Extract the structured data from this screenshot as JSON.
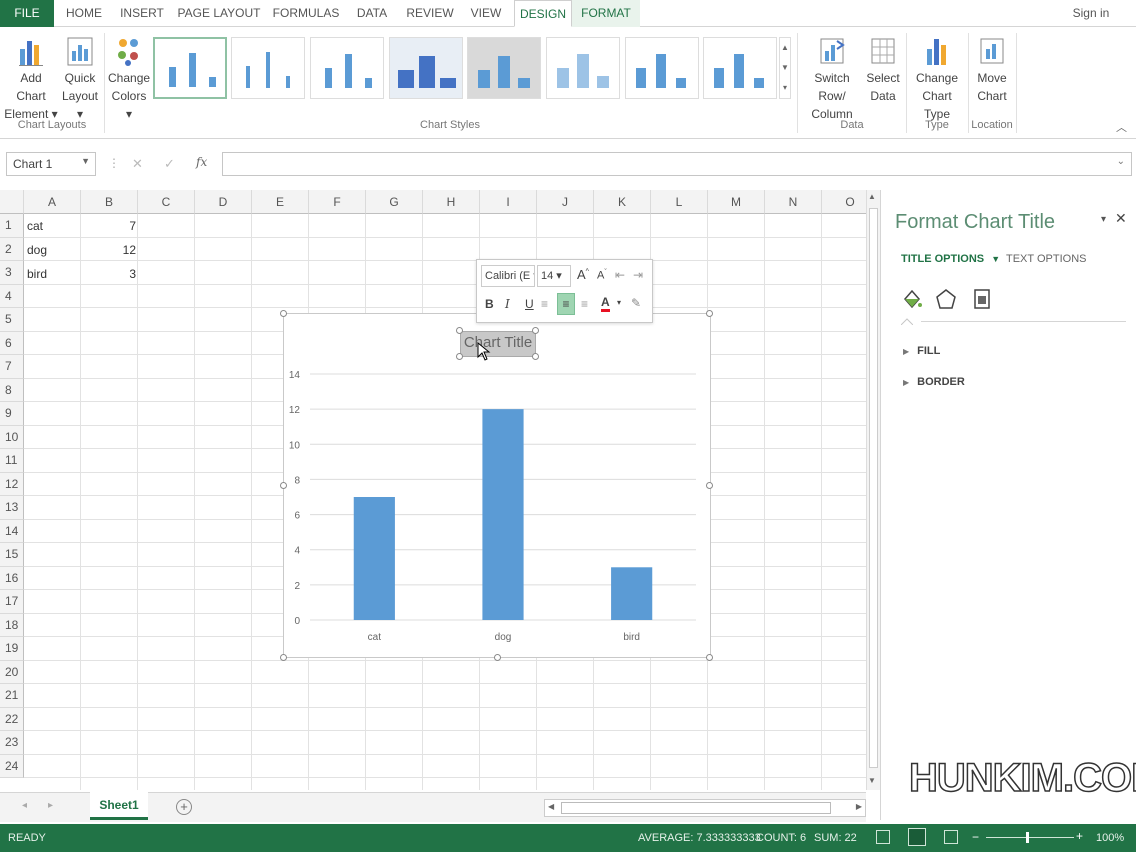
{
  "tabs": {
    "file": "FILE",
    "home": "HOME",
    "insert": "INSERT",
    "page_layout": "PAGE LAYOUT",
    "formulas": "FORMULAS",
    "data": "DATA",
    "review": "REVIEW",
    "view": "VIEW",
    "design": "DESIGN",
    "format": "FORMAT",
    "sign_in": "Sign in"
  },
  "ribbon": {
    "add_chart_element": [
      "Add Chart",
      "Element"
    ],
    "quick_layout": [
      "Quick",
      "Layout"
    ],
    "change_colors": [
      "Change",
      "Colors"
    ],
    "switch_row_column": [
      "Switch Row/",
      "Column"
    ],
    "select_data": [
      "Select",
      "Data"
    ],
    "change_chart_type": [
      "Change",
      "Chart Type"
    ],
    "move_chart": [
      "Move",
      "Chart"
    ],
    "groups": {
      "chart_layouts": "Chart Layouts",
      "chart_styles": "Chart Styles",
      "data": "Data",
      "type": "Type",
      "location": "Location"
    }
  },
  "formula_bar": {
    "name_box": "Chart 1",
    "fx": "fx",
    "value": ""
  },
  "columns": [
    "A",
    "B",
    "C",
    "D",
    "E",
    "F",
    "G",
    "H",
    "I",
    "J",
    "K",
    "L",
    "M",
    "N",
    "O"
  ],
  "rows": [
    "1",
    "2",
    "3",
    "4",
    "5",
    "6",
    "7",
    "8",
    "9",
    "10",
    "11",
    "12",
    "13",
    "14",
    "15",
    "16",
    "17",
    "18",
    "19",
    "20",
    "21",
    "22",
    "23",
    "24"
  ],
  "cells": [
    {
      "label": "cat",
      "value": "7"
    },
    {
      "label": "dog",
      "value": "12"
    },
    {
      "label": "bird",
      "value": "3"
    }
  ],
  "chart_data": {
    "type": "bar",
    "title": "Chart Title",
    "categories": [
      "cat",
      "dog",
      "bird"
    ],
    "values": [
      7,
      12,
      3
    ],
    "ylim": [
      0,
      14
    ],
    "yticks": [
      "0",
      "2",
      "4",
      "6",
      "8",
      "10",
      "12",
      "14"
    ],
    "grid": true,
    "bar_color": "#5b9bd5"
  },
  "mini_toolbar": {
    "font": "Calibri (E",
    "size": "14",
    "bold": "B",
    "italic": "I",
    "underline": "U",
    "font_color": "A"
  },
  "task_pane": {
    "title": "Format Chart Title",
    "title_options": "TITLE OPTIONS",
    "text_options": "TEXT OPTIONS",
    "sections": [
      "FILL",
      "BORDER"
    ]
  },
  "sheet_tab": "Sheet1",
  "status": {
    "ready": "READY",
    "average": "AVERAGE: 7.333333333",
    "count": "COUNT: 6",
    "sum": "SUM: 22",
    "zoom": "100%"
  },
  "watermark": "HUNKIM.COM",
  "colors": {
    "accent": "#217346",
    "bar": "#5b9bd5"
  }
}
